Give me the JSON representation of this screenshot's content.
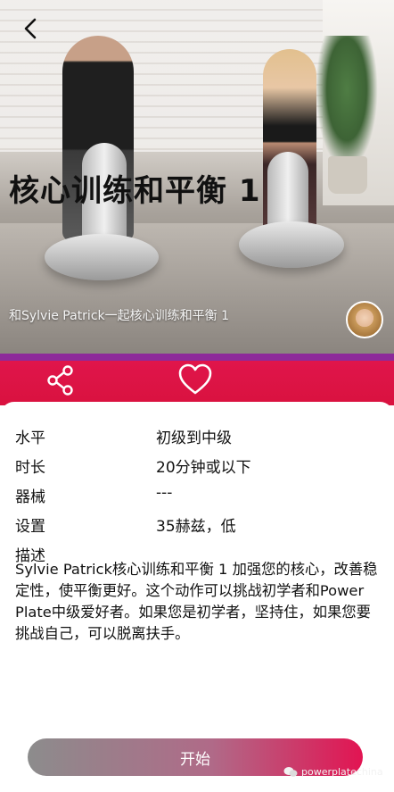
{
  "hero": {
    "title": "核心训练和平衡 1",
    "subtitle": "和Sylvie Patrick一起核心训练和平衡 1"
  },
  "icons": {
    "back": "chevron-left-icon",
    "share": "share-icon",
    "like": "heart-outline-icon",
    "watermark": "wechat-icon"
  },
  "colors": {
    "accent": "#e0154b",
    "accent_top": "#8d2a9a"
  },
  "details": [
    {
      "label": "水平",
      "value": "初级到中级"
    },
    {
      "label": "时长",
      "value": "20分钟或以下"
    },
    {
      "label": "器械",
      "value": "---"
    },
    {
      "label": "设置",
      "value": "35赫兹，低"
    }
  ],
  "description": {
    "label": "描述",
    "text": "Sylvie Patrick核心训练和平衡 1 加强您的核心，改善稳定性，使平衡更好。这个动作可以挑战初学者和Power Plate中级爱好者。如果您是初学者，坚持住，如果您要挑战自己，可以脱离扶手。"
  },
  "start_button": {
    "label": "开始"
  },
  "watermark": {
    "text": "powerplatechina"
  }
}
